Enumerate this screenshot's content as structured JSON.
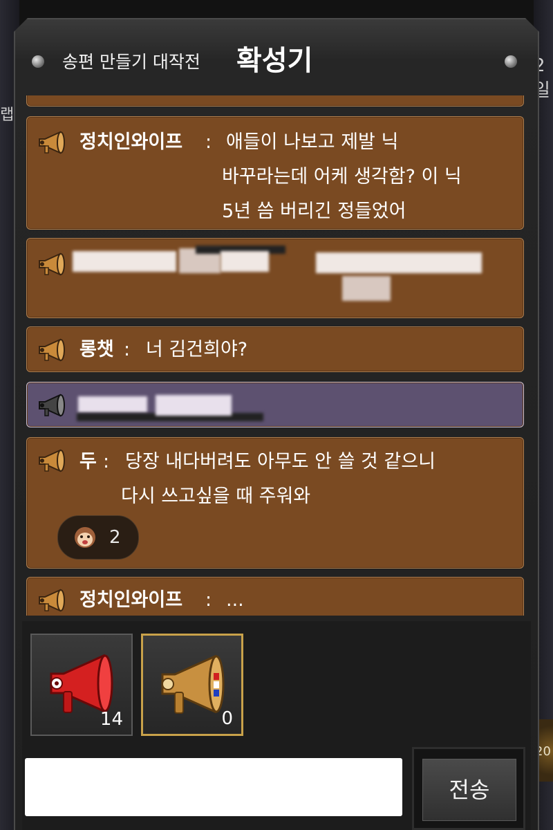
{
  "background": {
    "left_text": "랩",
    "right_text": "2일",
    "right_badge_text": "20"
  },
  "header": {
    "subtitle": "송편 만들기 대작전",
    "title": "확성기"
  },
  "messages": [
    {
      "sender": "정치인와이프",
      "separator": ":",
      "lines": [
        "애들이 나보고 제발 닉",
        "바꾸라는데 어케 생각함? 이 닉",
        "5년 씀 버리긴 정들었어"
      ],
      "style": "brown",
      "icon": "megaphone-gold-icon"
    },
    {
      "sender": "",
      "lines": [],
      "style": "brown",
      "censored": true,
      "icon": "megaphone-gold-icon"
    },
    {
      "sender": "롱챗",
      "separator": ":",
      "lines": [
        "너 김건희야?"
      ],
      "style": "brown",
      "icon": "megaphone-gold-icon"
    },
    {
      "sender": "",
      "lines": [],
      "style": "purple",
      "censored": true,
      "icon": "megaphone-dark-icon"
    },
    {
      "sender": "두",
      "separator": ":",
      "lines": [
        "당장 내다버려도 아무도 안 쓸 것 같으니",
        "다시 쓰고싶을 때 주워와"
      ],
      "style": "brown",
      "icon": "megaphone-gold-icon",
      "reaction": {
        "icon": "monkey-face-icon",
        "count": "2"
      }
    },
    {
      "sender": "정치인와이프",
      "separator": ":",
      "lines": [
        "..."
      ],
      "style": "brown",
      "icon": "megaphone-gold-icon"
    }
  ],
  "megaphone_slots": [
    {
      "icon": "red-megaphone-icon",
      "count": "14",
      "selected": false
    },
    {
      "icon": "gold-megaphone-icon",
      "count": "0",
      "selected": true
    }
  ],
  "input": {
    "placeholder": "",
    "value": ""
  },
  "send_button": {
    "label": "전송"
  },
  "colors": {
    "message_brown": "#7a4a22",
    "message_purple": "#5d5170",
    "selected_slot_border": "#c9a24a",
    "panel_bg": "#262626"
  }
}
